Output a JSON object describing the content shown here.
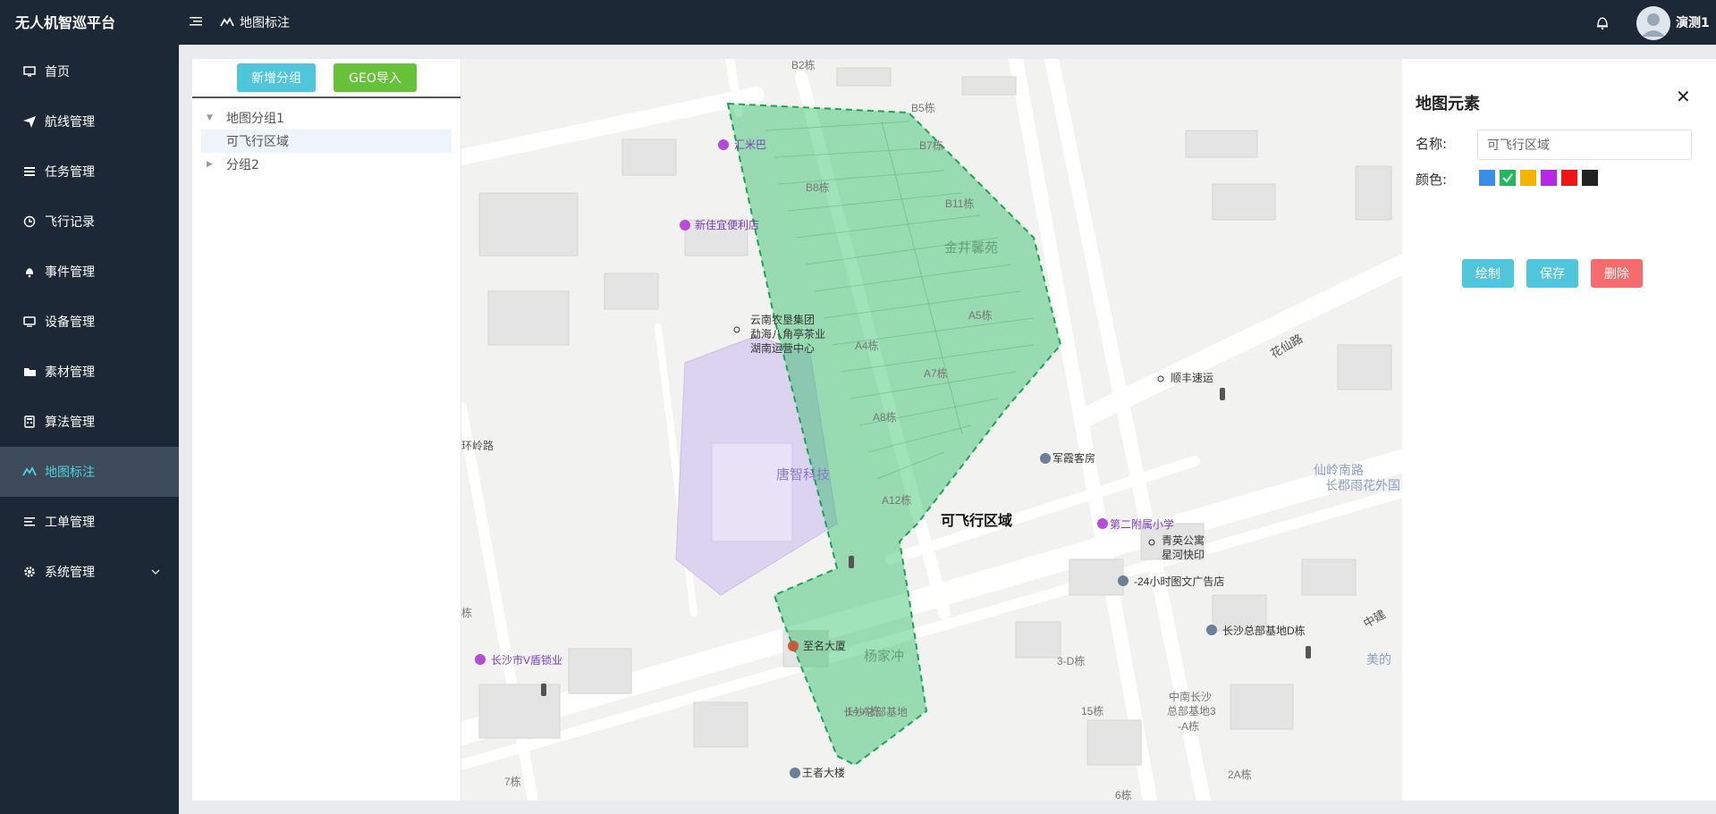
{
  "app": {
    "title": "无人机智巡平台",
    "breadcrumb": "地图标注",
    "user_name": "演测1"
  },
  "sidebar": {
    "items": [
      {
        "label": "首页",
        "icon": "monitor-icon"
      },
      {
        "label": "航线管理",
        "icon": "plane-icon"
      },
      {
        "label": "任务管理",
        "icon": "list-icon"
      },
      {
        "label": "飞行记录",
        "icon": "history-icon"
      },
      {
        "label": "事件管理",
        "icon": "bell-icon"
      },
      {
        "label": "设备管理",
        "icon": "screen-icon"
      },
      {
        "label": "素材管理",
        "icon": "folder-icon"
      },
      {
        "label": "算法管理",
        "icon": "calculator-icon"
      },
      {
        "label": "地图标注",
        "icon": "map-marker-icon",
        "active": true
      },
      {
        "label": "工单管理",
        "icon": "lines-icon"
      },
      {
        "label": "系统管理",
        "icon": "gear-icon"
      }
    ]
  },
  "left_panel": {
    "add_group_label": "新增分组",
    "geo_import_label": "GEO导入",
    "tree": [
      {
        "label": "地图分组1",
        "expanded": true,
        "children": [
          "可飞行区域"
        ]
      },
      {
        "label": "分组2",
        "expanded": false
      }
    ]
  },
  "map": {
    "area_label": "可飞行区域",
    "pois": [
      "B2栋",
      "B5栋",
      "B7栋",
      "B8栋",
      "B11栋",
      "金井馨苑",
      "A4栋",
      "A5栋",
      "A7栋",
      "A8栋",
      "A12栋",
      "汇米巴",
      "新佳宜便利店",
      "云南农垦集团",
      "勐海八角亭茶业",
      "湖南运营中心",
      "唐智科技",
      "花仙路",
      "军霞客房",
      "顺丰速运",
      "仙岭南路",
      "长郡雨花外国",
      "第二附属小学",
      "青英公寓",
      "星河快印",
      "-24小时图文广告店",
      "长沙总部基地D栋",
      "至名大厦",
      "杨家冲",
      "长沙总部基地",
      "3-D栋",
      "中南长沙",
      "总部基地3",
      "-A栋",
      "14-A栋",
      "15栋",
      "王者大楼",
      "2A栋",
      "7栋",
      "6栋",
      "长沙市V盾锁业",
      "环岭路",
      "中建",
      "美的",
      "栋"
    ]
  },
  "right_panel": {
    "title": "地图元素",
    "name_label": "名称:",
    "name_value": "可飞行区域",
    "color_label": "颜色:",
    "colors": [
      "#3a8ee6",
      "#1db95b",
      "#f5b400",
      "#b728e6",
      "#f01515",
      "#222222"
    ],
    "selected_color": "#1db95b",
    "draw_label": "绘制",
    "save_label": "保存",
    "delete_label": "删除"
  }
}
